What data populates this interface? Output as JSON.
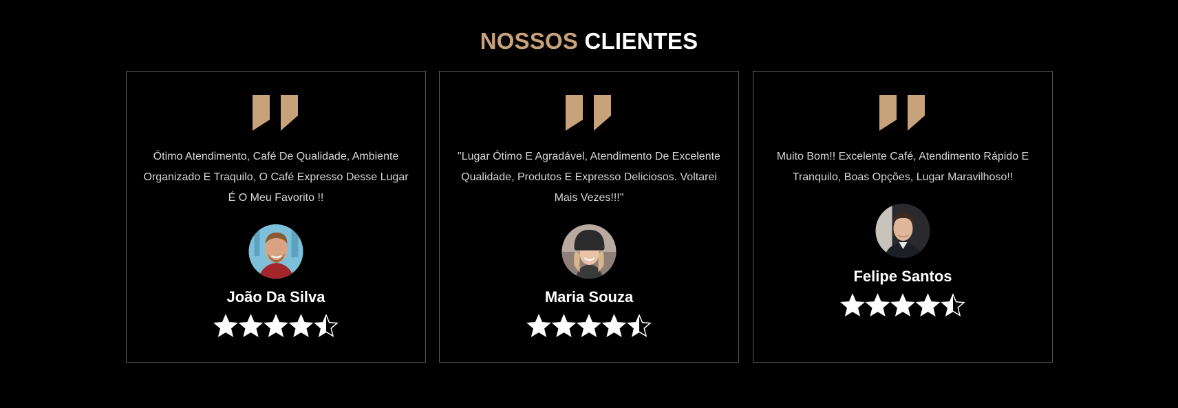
{
  "header": {
    "title_part1": "NOSSOS",
    "title_part2": "CLIENTES"
  },
  "colors": {
    "background": "#000000",
    "accent": "#c8a27a",
    "card_border": "#5a5a5a",
    "text": "#d6d6d6",
    "name": "#ffffff"
  },
  "testimonials": [
    {
      "text": "Ótimo Atendimento, Café De Qualidade, Ambiente Organizado E Traquilo, O Café Expresso Desse Lugar É O Meu Favorito !!",
      "name": "João Da Silva",
      "rating": 4.5,
      "avatar_icon": "avatar-man-smiling"
    },
    {
      "text": "\"Lugar Ótimo E Agradável, Atendimento De Excelente Qualidade, Produtos E Expresso Deliciosos. Voltarei Mais Vezes!!!\"",
      "name": "Maria Souza",
      "rating": 4.5,
      "avatar_icon": "avatar-woman-beanie"
    },
    {
      "text": "Muito Bom!! Excelente Café, Atendimento Rápido E Tranquilo, Boas Opções, Lugar Maravilhoso!!",
      "name": "Felipe Santos",
      "rating": 4.5,
      "avatar_icon": "avatar-man-suit"
    }
  ]
}
